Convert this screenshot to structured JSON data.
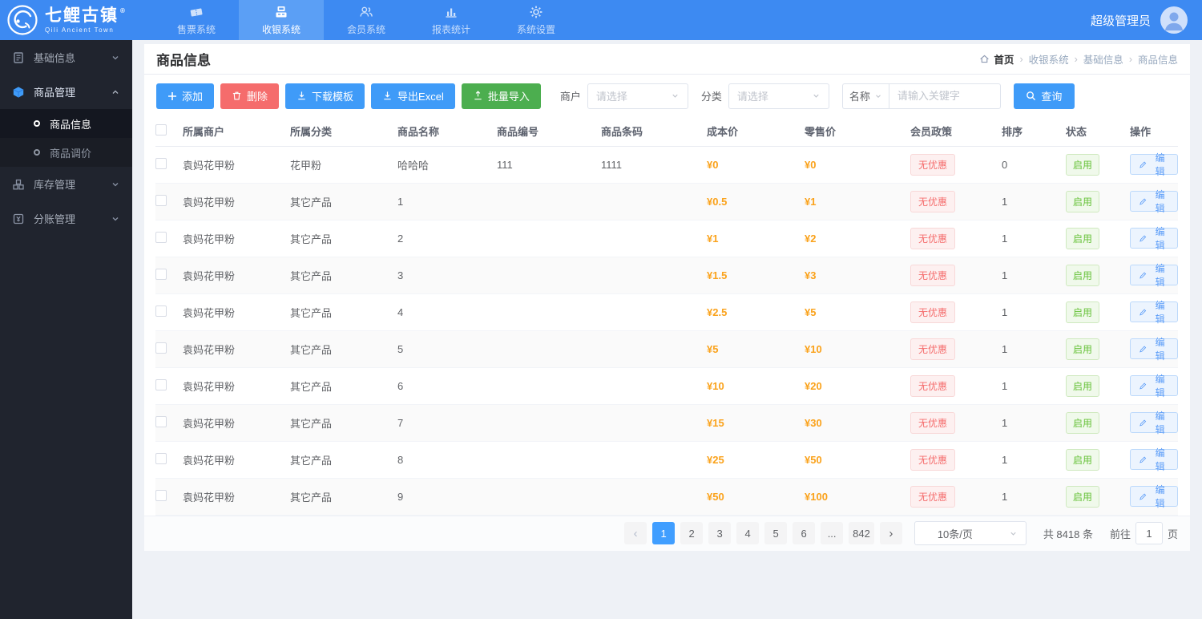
{
  "colors": {
    "navbar": "#3d8af2",
    "navbar_active": "#5b9ff5",
    "sidebar": "#20242e",
    "accent": "#409eff",
    "danger": "#f56c6c",
    "success": "#4cae4f",
    "price": "#faa21b",
    "status_green": "#67c23a"
  },
  "brand": {
    "name": "七鲤古镇",
    "seal": "®",
    "subtitle": "Qili Ancient Town"
  },
  "user": {
    "name": "超级管理员"
  },
  "topnav": {
    "items": [
      {
        "label": "售票系统",
        "active": false
      },
      {
        "label": "收银系统",
        "active": true
      },
      {
        "label": "会员系统",
        "active": false
      },
      {
        "label": "报表统计",
        "active": false
      },
      {
        "label": "系统设置",
        "active": false
      }
    ]
  },
  "sidebar": {
    "groups": [
      {
        "label": "基础信息",
        "expanded": false
      },
      {
        "label": "商品管理",
        "expanded": true
      },
      {
        "label": "库存管理",
        "expanded": false
      },
      {
        "label": "分账管理",
        "expanded": false
      }
    ],
    "submenu": [
      {
        "label": "商品信息",
        "active": true
      },
      {
        "label": "商品调价",
        "active": false
      }
    ]
  },
  "page": {
    "title": "商品信息",
    "breadcrumb": {
      "home": "首页",
      "items": [
        "收银系统",
        "基础信息",
        "商品信息"
      ]
    }
  },
  "toolbar": {
    "add": "添加",
    "delete": "删除",
    "download_template": "下载模板",
    "export_excel": "导出Excel",
    "batch_import": "批量导入"
  },
  "filters": {
    "merchant_label": "商户",
    "merchant_placeholder": "请选择",
    "category_label": "分类",
    "category_placeholder": "请选择",
    "keyword_field": "名称",
    "keyword_placeholder": "请输入关键字",
    "search": "查询"
  },
  "table": {
    "columns": [
      "所属商户",
      "所属分类",
      "商品名称",
      "商品编号",
      "商品条码",
      "成本价",
      "零售价",
      "会员政策",
      "排序",
      "状态",
      "操作"
    ],
    "rows": [
      {
        "merchant": "袁妈花甲粉",
        "category": "花甲粉",
        "name": "哈哈哈",
        "code": "111",
        "barcode": "1111",
        "cost": "¥0",
        "retail": "¥0",
        "policy": "无优惠",
        "sort": "0",
        "status": "启用",
        "action": "编辑"
      },
      {
        "merchant": "袁妈花甲粉",
        "category": "其它产品",
        "name": "1",
        "code": "",
        "barcode": "",
        "cost": "¥0.5",
        "retail": "¥1",
        "policy": "无优惠",
        "sort": "1",
        "status": "启用",
        "action": "编辑"
      },
      {
        "merchant": "袁妈花甲粉",
        "category": "其它产品",
        "name": "2",
        "code": "",
        "barcode": "",
        "cost": "¥1",
        "retail": "¥2",
        "policy": "无优惠",
        "sort": "1",
        "status": "启用",
        "action": "编辑"
      },
      {
        "merchant": "袁妈花甲粉",
        "category": "其它产品",
        "name": "3",
        "code": "",
        "barcode": "",
        "cost": "¥1.5",
        "retail": "¥3",
        "policy": "无优惠",
        "sort": "1",
        "status": "启用",
        "action": "编辑"
      },
      {
        "merchant": "袁妈花甲粉",
        "category": "其它产品",
        "name": "4",
        "code": "",
        "barcode": "",
        "cost": "¥2.5",
        "retail": "¥5",
        "policy": "无优惠",
        "sort": "1",
        "status": "启用",
        "action": "编辑"
      },
      {
        "merchant": "袁妈花甲粉",
        "category": "其它产品",
        "name": "5",
        "code": "",
        "barcode": "",
        "cost": "¥5",
        "retail": "¥10",
        "policy": "无优惠",
        "sort": "1",
        "status": "启用",
        "action": "编辑"
      },
      {
        "merchant": "袁妈花甲粉",
        "category": "其它产品",
        "name": "6",
        "code": "",
        "barcode": "",
        "cost": "¥10",
        "retail": "¥20",
        "policy": "无优惠",
        "sort": "1",
        "status": "启用",
        "action": "编辑"
      },
      {
        "merchant": "袁妈花甲粉",
        "category": "其它产品",
        "name": "7",
        "code": "",
        "barcode": "",
        "cost": "¥15",
        "retail": "¥30",
        "policy": "无优惠",
        "sort": "1",
        "status": "启用",
        "action": "编辑"
      },
      {
        "merchant": "袁妈花甲粉",
        "category": "其它产品",
        "name": "8",
        "code": "",
        "barcode": "",
        "cost": "¥25",
        "retail": "¥50",
        "policy": "无优惠",
        "sort": "1",
        "status": "启用",
        "action": "编辑"
      },
      {
        "merchant": "袁妈花甲粉",
        "category": "其它产品",
        "name": "9",
        "code": "",
        "barcode": "",
        "cost": "¥50",
        "retail": "¥100",
        "policy": "无优惠",
        "sort": "1",
        "status": "启用",
        "action": "编辑"
      }
    ]
  },
  "pagination": {
    "prev": "‹",
    "next": "›",
    "pages": [
      {
        "label": "1",
        "state": "active"
      },
      {
        "label": "2",
        "state": ""
      },
      {
        "label": "3",
        "state": ""
      },
      {
        "label": "4",
        "state": ""
      },
      {
        "label": "5",
        "state": ""
      },
      {
        "label": "6",
        "state": ""
      },
      {
        "label": "...",
        "state": ""
      },
      {
        "label": "842",
        "state": ""
      }
    ],
    "page_size": "10条/页",
    "total": "共 8418 条",
    "goto_prefix": "前往",
    "goto_value": "1",
    "goto_suffix": "页"
  }
}
